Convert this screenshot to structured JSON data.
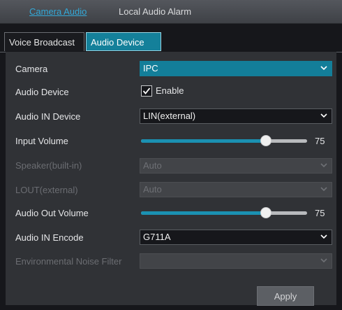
{
  "top_tabs": [
    {
      "label": "Camera Audio",
      "active": true
    },
    {
      "label": "Local Audio Alarm",
      "active": false
    }
  ],
  "sub_tabs": [
    {
      "label": "Voice Broadcast",
      "active": false
    },
    {
      "label": "Audio Device",
      "active": true
    }
  ],
  "form": {
    "camera": {
      "label": "Camera",
      "value": "IPC"
    },
    "audio_device": {
      "label": "Audio Device",
      "checkbox_label": "Enable",
      "checked": true
    },
    "audio_in_device": {
      "label": "Audio IN Device",
      "value": "LIN(external)"
    },
    "input_volume": {
      "label": "Input Volume",
      "value": "75",
      "level": 75
    },
    "speaker_builtin": {
      "label": "Speaker(built-in)",
      "value": "Auto",
      "disabled": true
    },
    "lout_external": {
      "label": "LOUT(external)",
      "value": "Auto",
      "disabled": true
    },
    "audio_out_volume": {
      "label": "Audio Out Volume",
      "value": "75",
      "level": 75
    },
    "audio_in_encode": {
      "label": "Audio IN Encode",
      "value": "G711A"
    },
    "noise_filter": {
      "label": "Environmental Noise Filter",
      "value": "",
      "disabled": true
    }
  },
  "apply_label": "Apply",
  "icons": {
    "dropdown": "chevron-down-icon",
    "check": "checkmark-icon"
  },
  "colors": {
    "accent": "#137e99",
    "active_tab_text": "#33a9d8",
    "panel": "#303236"
  }
}
